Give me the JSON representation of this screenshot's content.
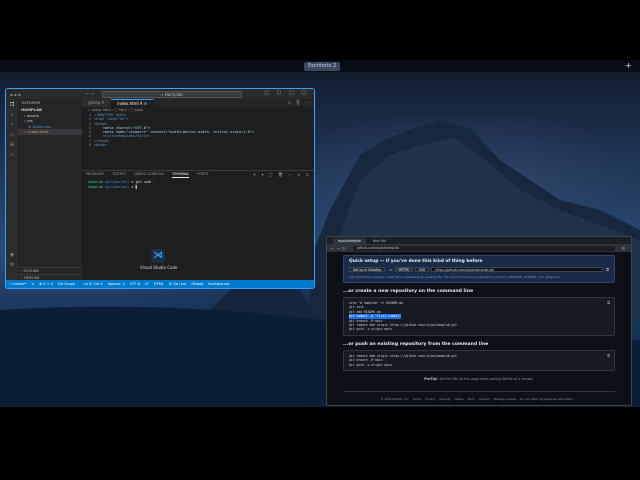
{
  "desktop": {
    "workspace_label": "Escritorio 2",
    "add_workspace": "+"
  },
  "vscode": {
    "search_text": "⌕ Hamplab",
    "window_controls": "▢ ▢ ▢ ▢",
    "sidebar": {
      "header": "EXPLORER",
      "project": "HAMPLAB",
      "items": [
        {
          "label": "› assets"
        },
        {
          "label": "› css"
        },
        {
          "label": "# styles.css"
        },
        {
          "label": "‹› index.html"
        }
      ],
      "outline": "› OUTLINE",
      "timeline": "› TIMELINE"
    },
    "tabs": [
      {
        "label": "gitosp  A"
      },
      {
        "label": "index.html  A  ×"
      }
    ],
    "breadcrumbs": "‹› index.html  ›  ▢ html  ›  ▢ body",
    "code_lines": [
      {
        "n": "1",
        "text": "<!DOCTYPE html>"
      },
      {
        "n": "2",
        "text": "<html lang=\"en\">"
      },
      {
        "n": "3",
        "text": "<head>"
      },
      {
        "n": "4",
        "text": "    <meta charset=\"UTF-8\">"
      },
      {
        "n": "5",
        "text": "    <meta name=\"viewport\" content=\"width=device-width, initial-scale=1.0\">"
      },
      {
        "n": "6",
        "text": "    <title>Hamplab</title>"
      },
      {
        "n": "7",
        "text": "</head>"
      },
      {
        "n": "8",
        "text": "<body>"
      }
    ],
    "panel_tabs": [
      "PROBLEMS",
      "OUTPUT",
      "DEBUG CONSOLE",
      "TERMINAL",
      "PORTS"
    ],
    "panel_controls": "+ ▾ ▢ 🗑 ⋯ ∧ ×",
    "terminal_lines": [
      {
        "user": "hamplab",
        "path": "git(master)",
        "cmd": " ✗ git add ."
      },
      {
        "user": "hamplab",
        "path": "git(master)",
        "cmd": " ✗ ▌"
      }
    ],
    "status": {
      "branch": "⑂ master*",
      "sync": "↻",
      "problems": "⊗ 0 ⚠ 0",
      "graph": "Git Graph",
      "position": "Ln 8, Col 5",
      "spaces": "Spaces: 4",
      "encoding": "UTF-8",
      "eol": "LF",
      "lang": "HTML",
      "golive": "⦿ Go Live",
      "extra1": "Reload",
      "extra2": "Background"
    },
    "dock_tooltip": "Visual Studio Code",
    "dock_icon_glyph": "⋊"
  },
  "browser": {
    "tabs": [
      {
        "label": "rojas/hamplab"
      },
      {
        "label": "New Tab"
      }
    ],
    "url": "github.com/rojas/hamplab",
    "quick_setup": {
      "title": "Quick setup — if you've done this kind of thing before",
      "desktop_btn": "Set up in Desktop",
      "or": "or",
      "https": "HTTPS",
      "ssh": "SSH",
      "repo_url": "https://github.com/rojas/hamplab.git",
      "hint_prefix": "Get started by ",
      "hint_link1": "creating a new file",
      "hint_mid": " or ",
      "hint_link2": "uploading an existing file",
      "hint_suffix": ". We recommend every repository include a README, LICENSE, and .gitignore."
    },
    "create_title": "...or create a new repository on the command line",
    "create_lines": [
      "echo \"# hamplab\" >> README.md",
      "git init",
      "git add README.md",
      "git commit -m \"first commit\"",
      "git branch -M main",
      "git remote add origin https://github.com/rojas/hamplab.git",
      "git push -u origin main"
    ],
    "push_title": "...or push an existing repository from the command line",
    "push_lines": [
      "git remote add origin https://github.com/rojas/hamplab.git",
      "git branch -M main",
      "git push -u origin main"
    ],
    "protip_label": "ProTip!",
    "protip_text": " Use the URL for this page when adding GitHub as a remote.",
    "footer": [
      "© 2024 GitHub, Inc.",
      "Terms",
      "Privacy",
      "Security",
      "Status",
      "Docs",
      "Contact",
      "Manage cookies",
      "Do not share my personal information"
    ],
    "copy_glyph": "⧉"
  }
}
